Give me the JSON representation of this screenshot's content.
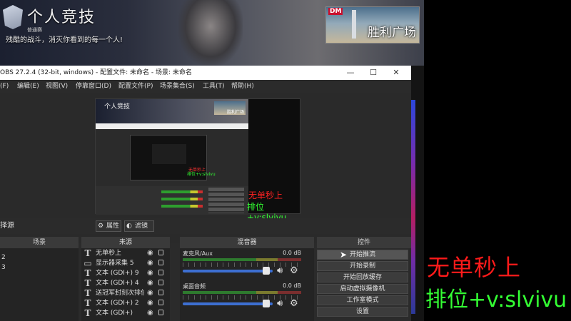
{
  "banner": {
    "title": "个人竞技",
    "subtitle_small": "普通赛",
    "slogan": "残酷的战斗，消灭你看到的每一个人!",
    "victory_badge": "DM",
    "victory_text": "胜利广场"
  },
  "obs": {
    "window_title": "OBS 27.2.4 (32-bit, windows) - 配置文件: 未命名 - 场景: 未命名",
    "menu": [
      "(F)",
      "编辑(E)",
      "视图(V)",
      "停靠窗口(D)",
      "配置文件(P)",
      "场景集合(S)",
      "工具(T)",
      "帮助(H)"
    ],
    "preview": {
      "mini_title": "个人竞技",
      "mini_victory": "胜利广场",
      "overlay_red": "无单秒上",
      "overlay_green": "排位+v:slvivu",
      "mini_inner_red": "无单秒上",
      "mini_inner_green": "排位+v:slvivu"
    },
    "source_toolbar": {
      "label": "择源",
      "properties": "属性",
      "filters": "滤镜"
    },
    "docks": {
      "scenes_header": "场景",
      "sources_header": "来源",
      "mixer_header": "混音器",
      "controls_header": "控件",
      "scenes": [
        "2",
        "3"
      ],
      "sources": [
        {
          "icon": "T",
          "label": "无单秒上"
        },
        {
          "icon": "▭",
          "label": "显示器采集 5"
        },
        {
          "icon": "T",
          "label": "文本 (GDI+) 9"
        },
        {
          "icon": "T",
          "label": "文本 (GDI+) 4"
        },
        {
          "icon": "T",
          "label": "送冠军封刻次排位"
        },
        {
          "icon": "T",
          "label": "文本 (GDI+) 2"
        },
        {
          "icon": "T",
          "label": "文本 (GDI+)"
        }
      ],
      "mixer": [
        {
          "name": "麦克风/Aux",
          "db": "0.0 dB",
          "level": 0.62
        },
        {
          "name": "桌面音频",
          "db": "0.0 dB",
          "level": 0.62
        }
      ],
      "controls": [
        "开始推流",
        "开始录制",
        "开始回放缓存",
        "启动虚拟摄像机",
        "工作室模式",
        "设置"
      ]
    }
  },
  "overlay": {
    "line1": "无单秒上",
    "line2": "排位+v:slvivu"
  },
  "colors": {
    "overlay_red": "#ff1a1a",
    "overlay_green": "#33ff33",
    "obs_bg": "#2b2b2b",
    "slider_blue": "#3d6fd1"
  }
}
